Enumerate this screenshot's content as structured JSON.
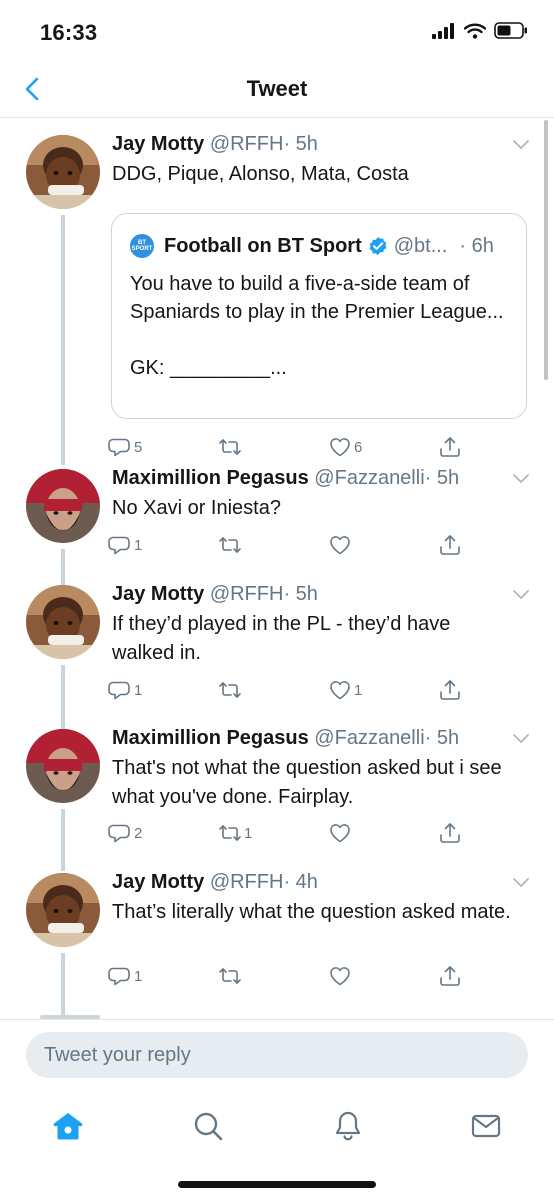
{
  "status": {
    "time": "16:33"
  },
  "nav": {
    "title": "Tweet"
  },
  "tweets": [
    {
      "name": "Jay Motty",
      "handle": "@RFFH",
      "time": "· 5h",
      "text": "DDG, Pique, Alonso, Mata, Costa",
      "replies": "5",
      "retweets": "",
      "likes": "6",
      "quote": {
        "logo_text": "BT SPORT FOOTBALL",
        "name": "Football on BT Sport",
        "handle": "@bt...",
        "time": "· 6h",
        "text": "You have to build a five-a-side team of Spaniards to play in the Premier League...\n\nGK: _________..."
      }
    },
    {
      "name": "Maximillion Pegasus",
      "handle": "@Fazzanelli",
      "time": "· 5h",
      "text": "No Xavi or Iniesta?",
      "replies": "1",
      "retweets": "",
      "likes": ""
    },
    {
      "name": "Jay Motty",
      "handle": "@RFFH",
      "time": "· 5h",
      "text": "If they’d played in the PL - they’d have walked in.",
      "replies": "1",
      "retweets": "",
      "likes": "1"
    },
    {
      "name": "Maximillion Pegasus",
      "handle": "@Fazzanelli",
      "time": "· 5h",
      "text": "That's not what the question asked but i see what you've done. Fairplay.",
      "replies": "2",
      "retweets": "1",
      "likes": ""
    },
    {
      "name": "Jay Motty",
      "handle": "@RFFH",
      "time": "· 4h",
      "text": "That’s literally what the question asked mate.",
      "replies": "1",
      "retweets": "",
      "likes": ""
    }
  ],
  "reply": {
    "placeholder": "Tweet your reply"
  },
  "tabs": [
    "home-icon",
    "search-icon",
    "notifications-icon",
    "messages-icon"
  ],
  "colors": {
    "accent": "#1da1f2",
    "muted": "#657786",
    "thread": "#c8d3dc"
  }
}
